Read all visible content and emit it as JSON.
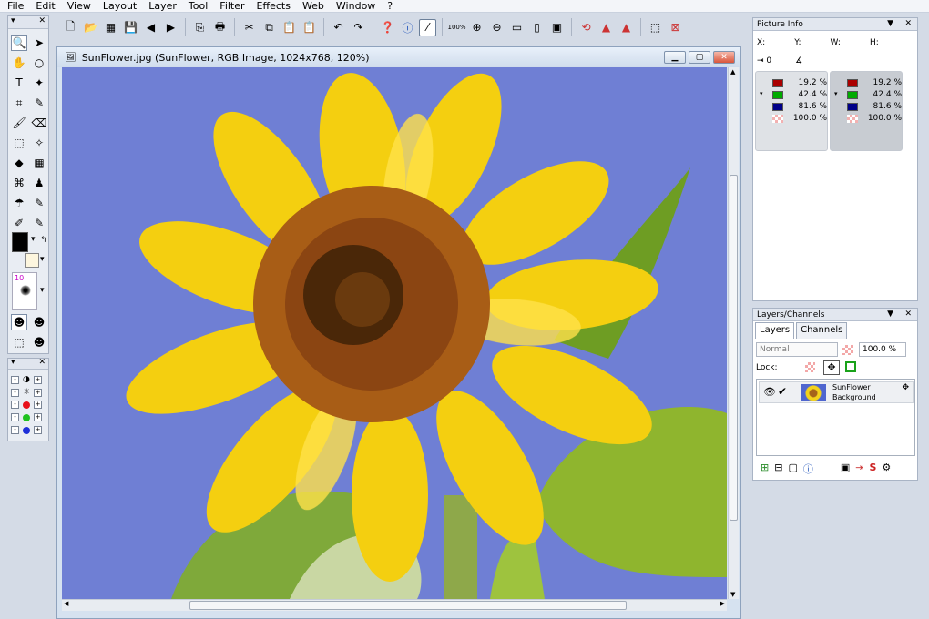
{
  "menu": [
    "File",
    "Edit",
    "View",
    "Layout",
    "Layer",
    "Tool",
    "Filter",
    "Effects",
    "Web",
    "Window",
    "?"
  ],
  "toolbar": {
    "icons": [
      "new-icon",
      "open-icon",
      "browse-icon",
      "save-icon",
      "back-icon",
      "forward-icon",
      "scan-icon",
      "print-icon",
      "cut-icon",
      "copy-icon",
      "paste-icon",
      "paste-into-icon",
      "undo-icon",
      "redo-icon",
      "help-icon",
      "info-icon",
      "grid-icon"
    ],
    "zoom_label": "100%",
    "zoom_icons": [
      "zoom-in-icon",
      "zoom-out-icon",
      "fit-icon",
      "actual-size-icon",
      "rotate-icon",
      "flip-icon",
      "mirror-icon",
      "crop-icon",
      "resize-icon"
    ]
  },
  "document": {
    "title": "SunFlower.jpg  (SunFlower, RGB Image, 1024x768, 120%)",
    "btn_min": "▁",
    "btn_max": "▢",
    "btn_close": "✕"
  },
  "picture_info": {
    "header": "Picture Info",
    "labels": [
      "X:",
      "Y:",
      "W:",
      "H:"
    ],
    "offset_label": "0",
    "left": {
      "red": "19.2 %",
      "green": "42.4 %",
      "blue": "81.6 %",
      "alpha": "100.0 %"
    },
    "right": {
      "red": "19.2 %",
      "green": "42.4 %",
      "blue": "81.6 %",
      "alpha": "100.0 %"
    }
  },
  "layers": {
    "header": "Layers/Channels",
    "tab_layers": "Layers",
    "tab_channels": "Channels",
    "blend_mode": "Normal",
    "opacity": "100.0 %",
    "lock_label": "Lock:",
    "layer_name": "SunFlower",
    "layer_type": "Background"
  },
  "tools": {
    "brush_size": "10"
  },
  "colors": {
    "sky": "#6f7fd4",
    "petal": "#f4cf10",
    "center": "#a85d16",
    "leaf": "#8fb52e"
  }
}
